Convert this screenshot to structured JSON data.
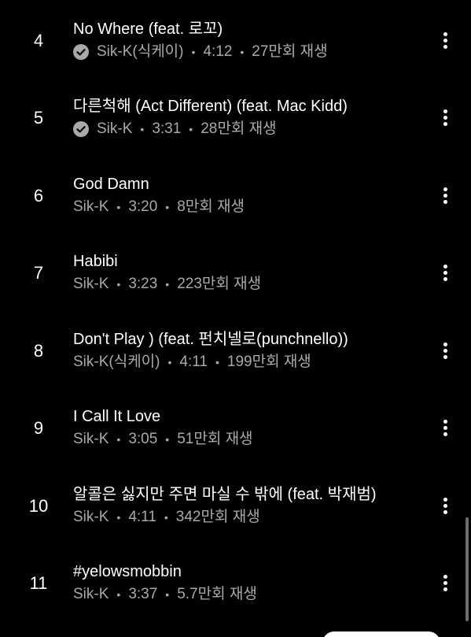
{
  "tracks": [
    {
      "number": "4",
      "title": "No Where (feat. 로꼬)",
      "verified": true,
      "artist": "Sik-K(식케이)",
      "duration": "4:12",
      "plays": "27만회 재생"
    },
    {
      "number": "5",
      "title": "다른척해 (Act Different) (feat. Mac Kidd)",
      "verified": true,
      "artist": "Sik-K",
      "duration": "3:31",
      "plays": "28만회 재생"
    },
    {
      "number": "6",
      "title": "God Damn",
      "verified": false,
      "artist": "Sik-K",
      "duration": "3:20",
      "plays": "8만회 재생"
    },
    {
      "number": "7",
      "title": "Habibi",
      "verified": false,
      "artist": "Sik-K",
      "duration": "3:23",
      "plays": "223만회 재생"
    },
    {
      "number": "8",
      "title": "Don't Play ) (feat. 펀치넬로(punchnello))",
      "verified": false,
      "artist": "Sik-K(식케이)",
      "duration": "4:11",
      "plays": "199만회 재생"
    },
    {
      "number": "9",
      "title": "I Call It Love",
      "verified": false,
      "artist": "Sik-K",
      "duration": "3:05",
      "plays": "51만회 재생"
    },
    {
      "number": "10",
      "title": "알콜은 싫지만 주면 마실 수 밖에 (feat. 박재범)",
      "verified": false,
      "artist": "Sik-K",
      "duration": "4:11",
      "plays": "342만회 재생"
    },
    {
      "number": "11",
      "title": "#yelowsmobbin",
      "verified": false,
      "artist": "Sik-K",
      "duration": "3:37",
      "plays": "5.7만회 재생"
    }
  ],
  "separator": "•",
  "icons": {
    "verified": "verified-check-icon",
    "more": "more-vert-icon"
  },
  "colors": {
    "background": "#000000",
    "title": "#ffffff",
    "meta": "#a9a9a9"
  }
}
